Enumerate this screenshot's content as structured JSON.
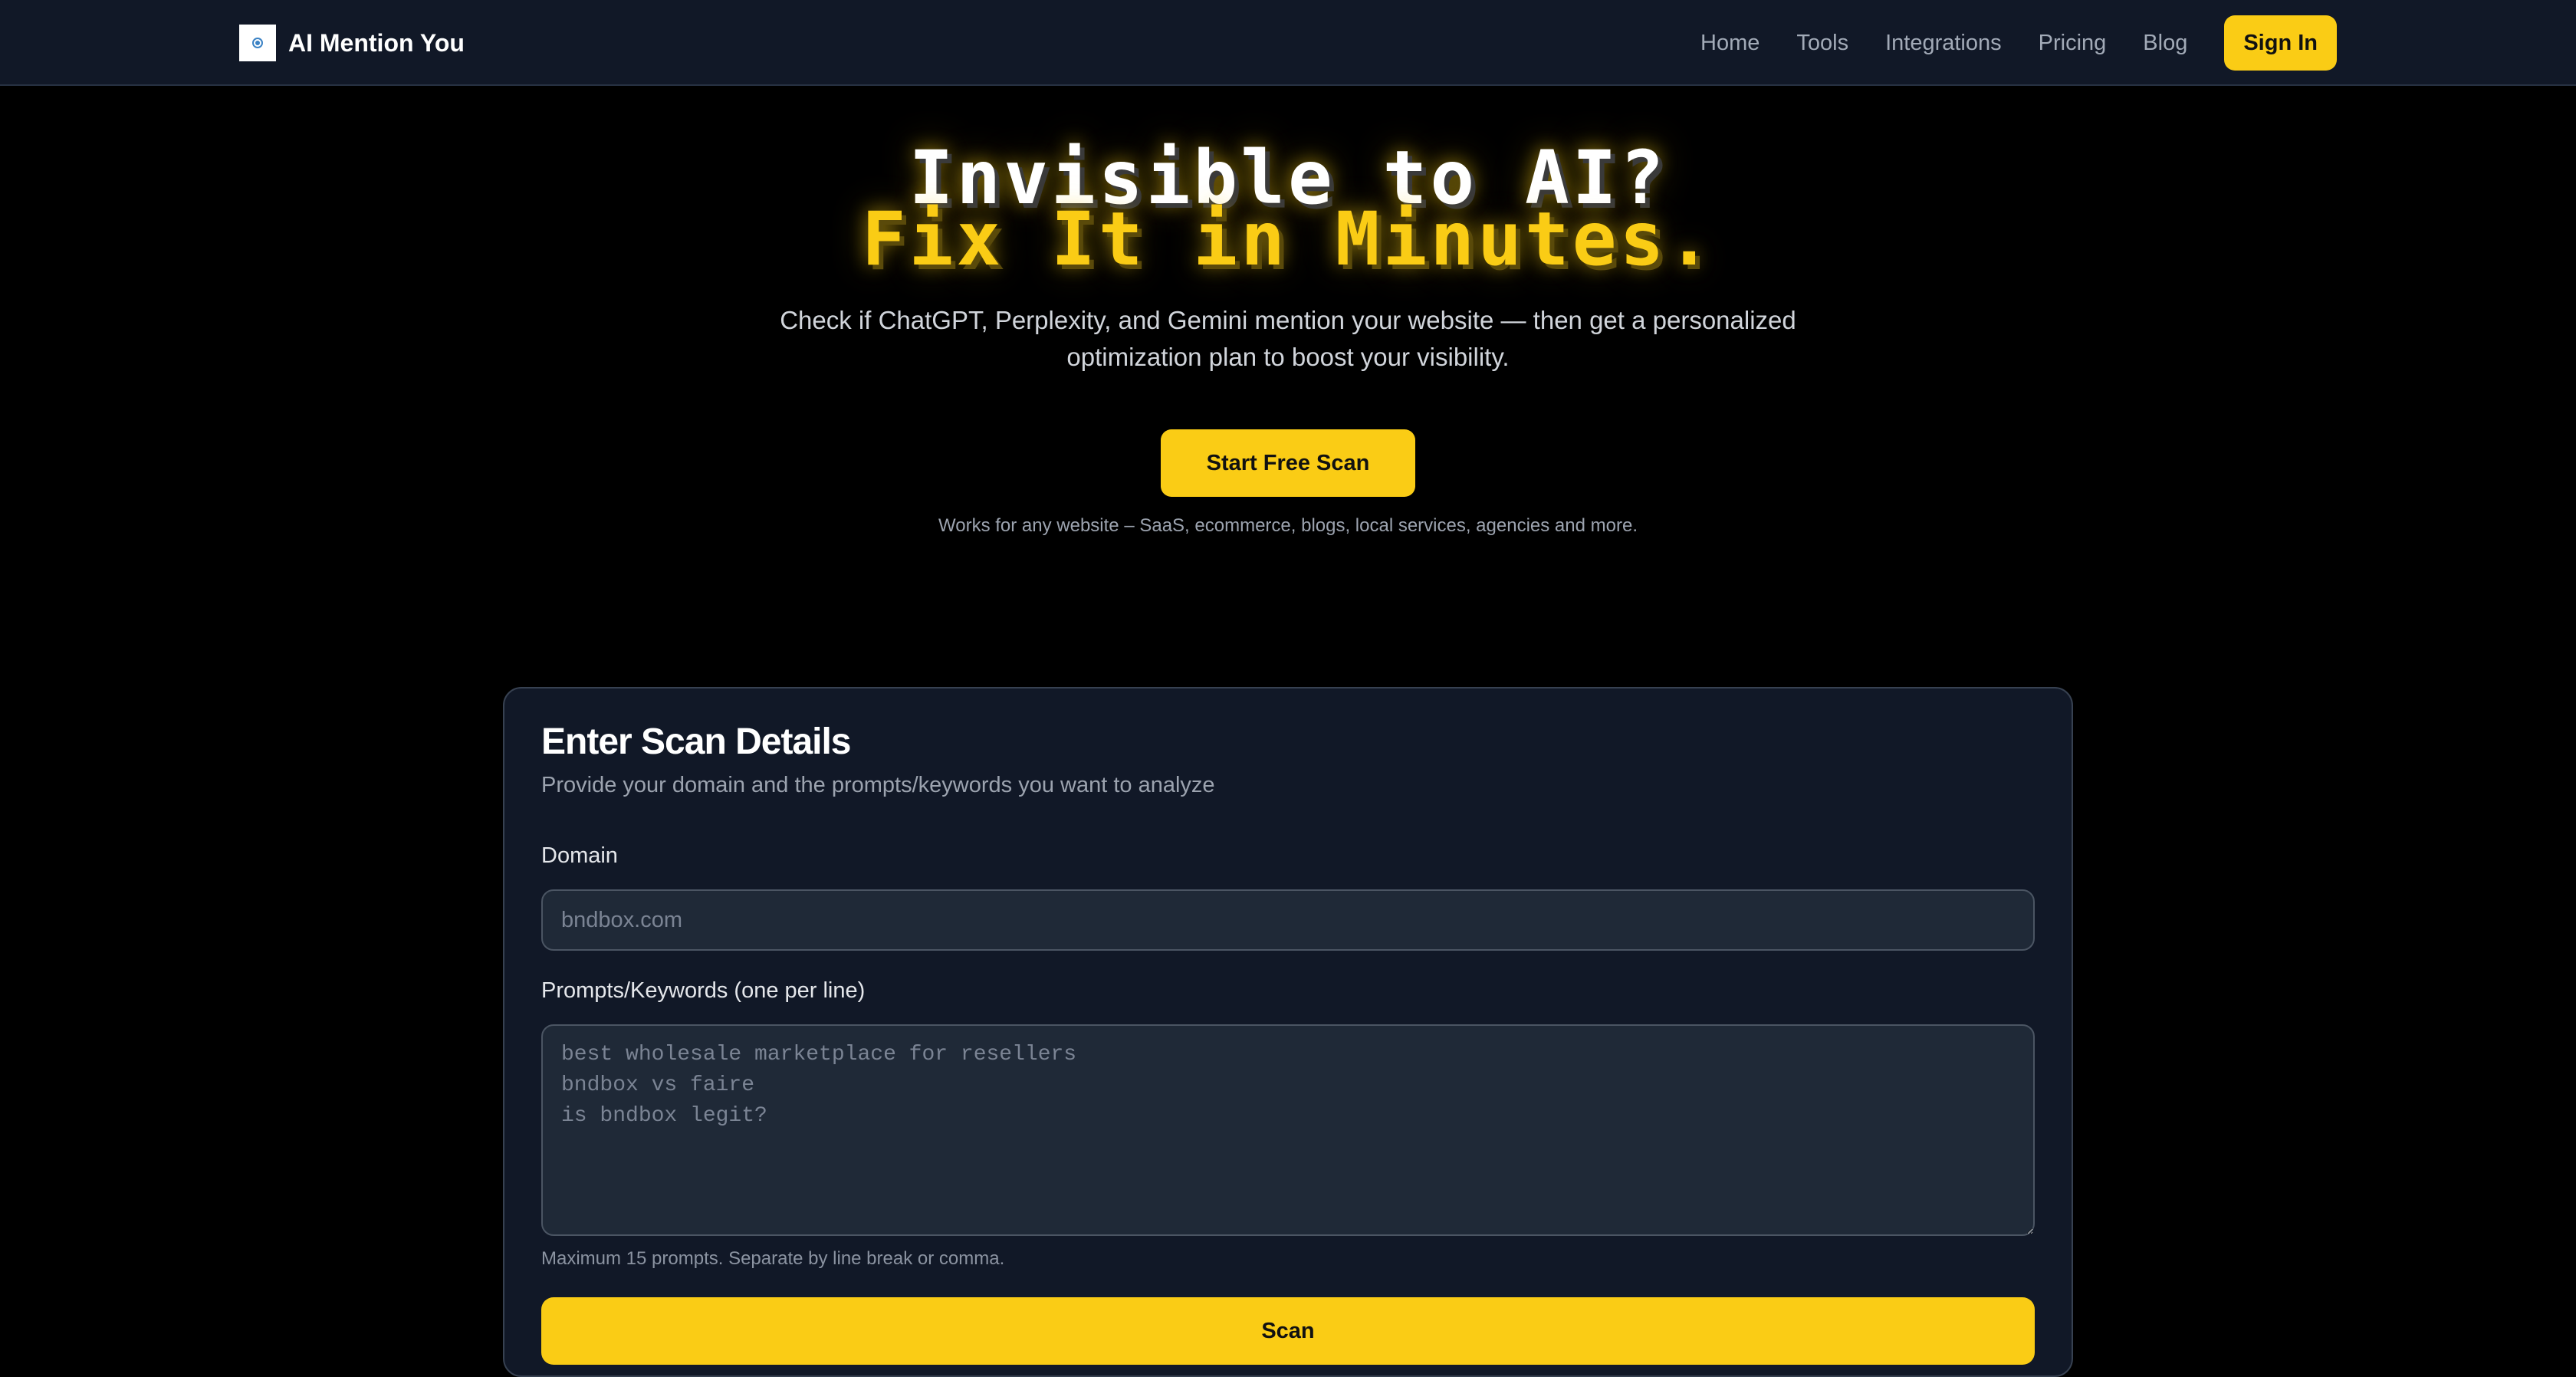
{
  "nav": {
    "brand": "AI Mention You",
    "links": [
      "Home",
      "Tools",
      "Integrations",
      "Pricing",
      "Blog"
    ],
    "signin_label": "Sign In",
    "logo_icon": "target-icon"
  },
  "hero": {
    "headline_line1": "Invisible to AI?",
    "headline_line2": "Fix It in Minutes.",
    "subtitle": "Check if ChatGPT, Perplexity, and Gemini mention your website — then get a personalized optimization plan to boost your visibility.",
    "cta_label": "Start Free Scan",
    "works_note": "Works for any website – SaaS, ecommerce, blogs, local services, agencies and more."
  },
  "scan_form": {
    "title": "Enter Scan Details",
    "description": "Provide your domain and the prompts/keywords you want to analyze",
    "domain_label": "Domain",
    "domain_placeholder": "bndbox.com",
    "domain_value": "",
    "prompts_label": "Prompts/Keywords (one per line)",
    "prompts_placeholder": "best wholesale marketplace for resellers\nbndbox vs faire\nis bndbox legit?",
    "prompts_value": "",
    "hint": "Maximum 15 prompts. Separate by line break or comma.",
    "submit_label": "Scan"
  },
  "colors": {
    "accent": "#facc15",
    "nav_bg": "#111827",
    "page_bg": "#000000",
    "card_bg": "#111827",
    "input_bg": "#1f2937"
  }
}
